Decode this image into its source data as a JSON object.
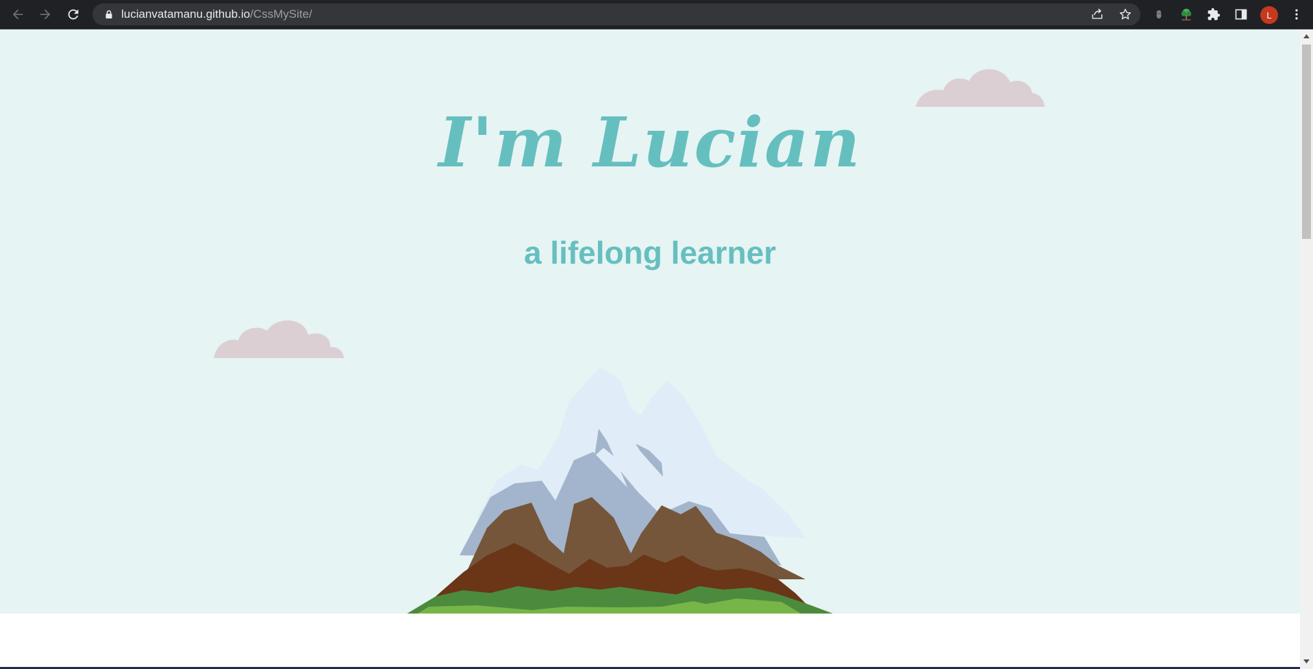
{
  "browser": {
    "url_host": "lucianvatamanu.github.io",
    "url_path": "/CssMySite/",
    "avatar_letter": "L",
    "icons": [
      "back-icon",
      "forward-icon",
      "reload-icon",
      "lock-icon",
      "share-icon",
      "star-icon",
      "extension-icon",
      "tree-extension-icon",
      "puzzle-icon",
      "side-panel-icon",
      "menu-icon"
    ]
  },
  "page": {
    "title": "I'm Lucian",
    "subtitle": "a lifelong learner"
  },
  "colors": {
    "accent": "#66bfbf",
    "hero_bg": "#e6f4f3",
    "cloud": "#dbcfd4"
  }
}
